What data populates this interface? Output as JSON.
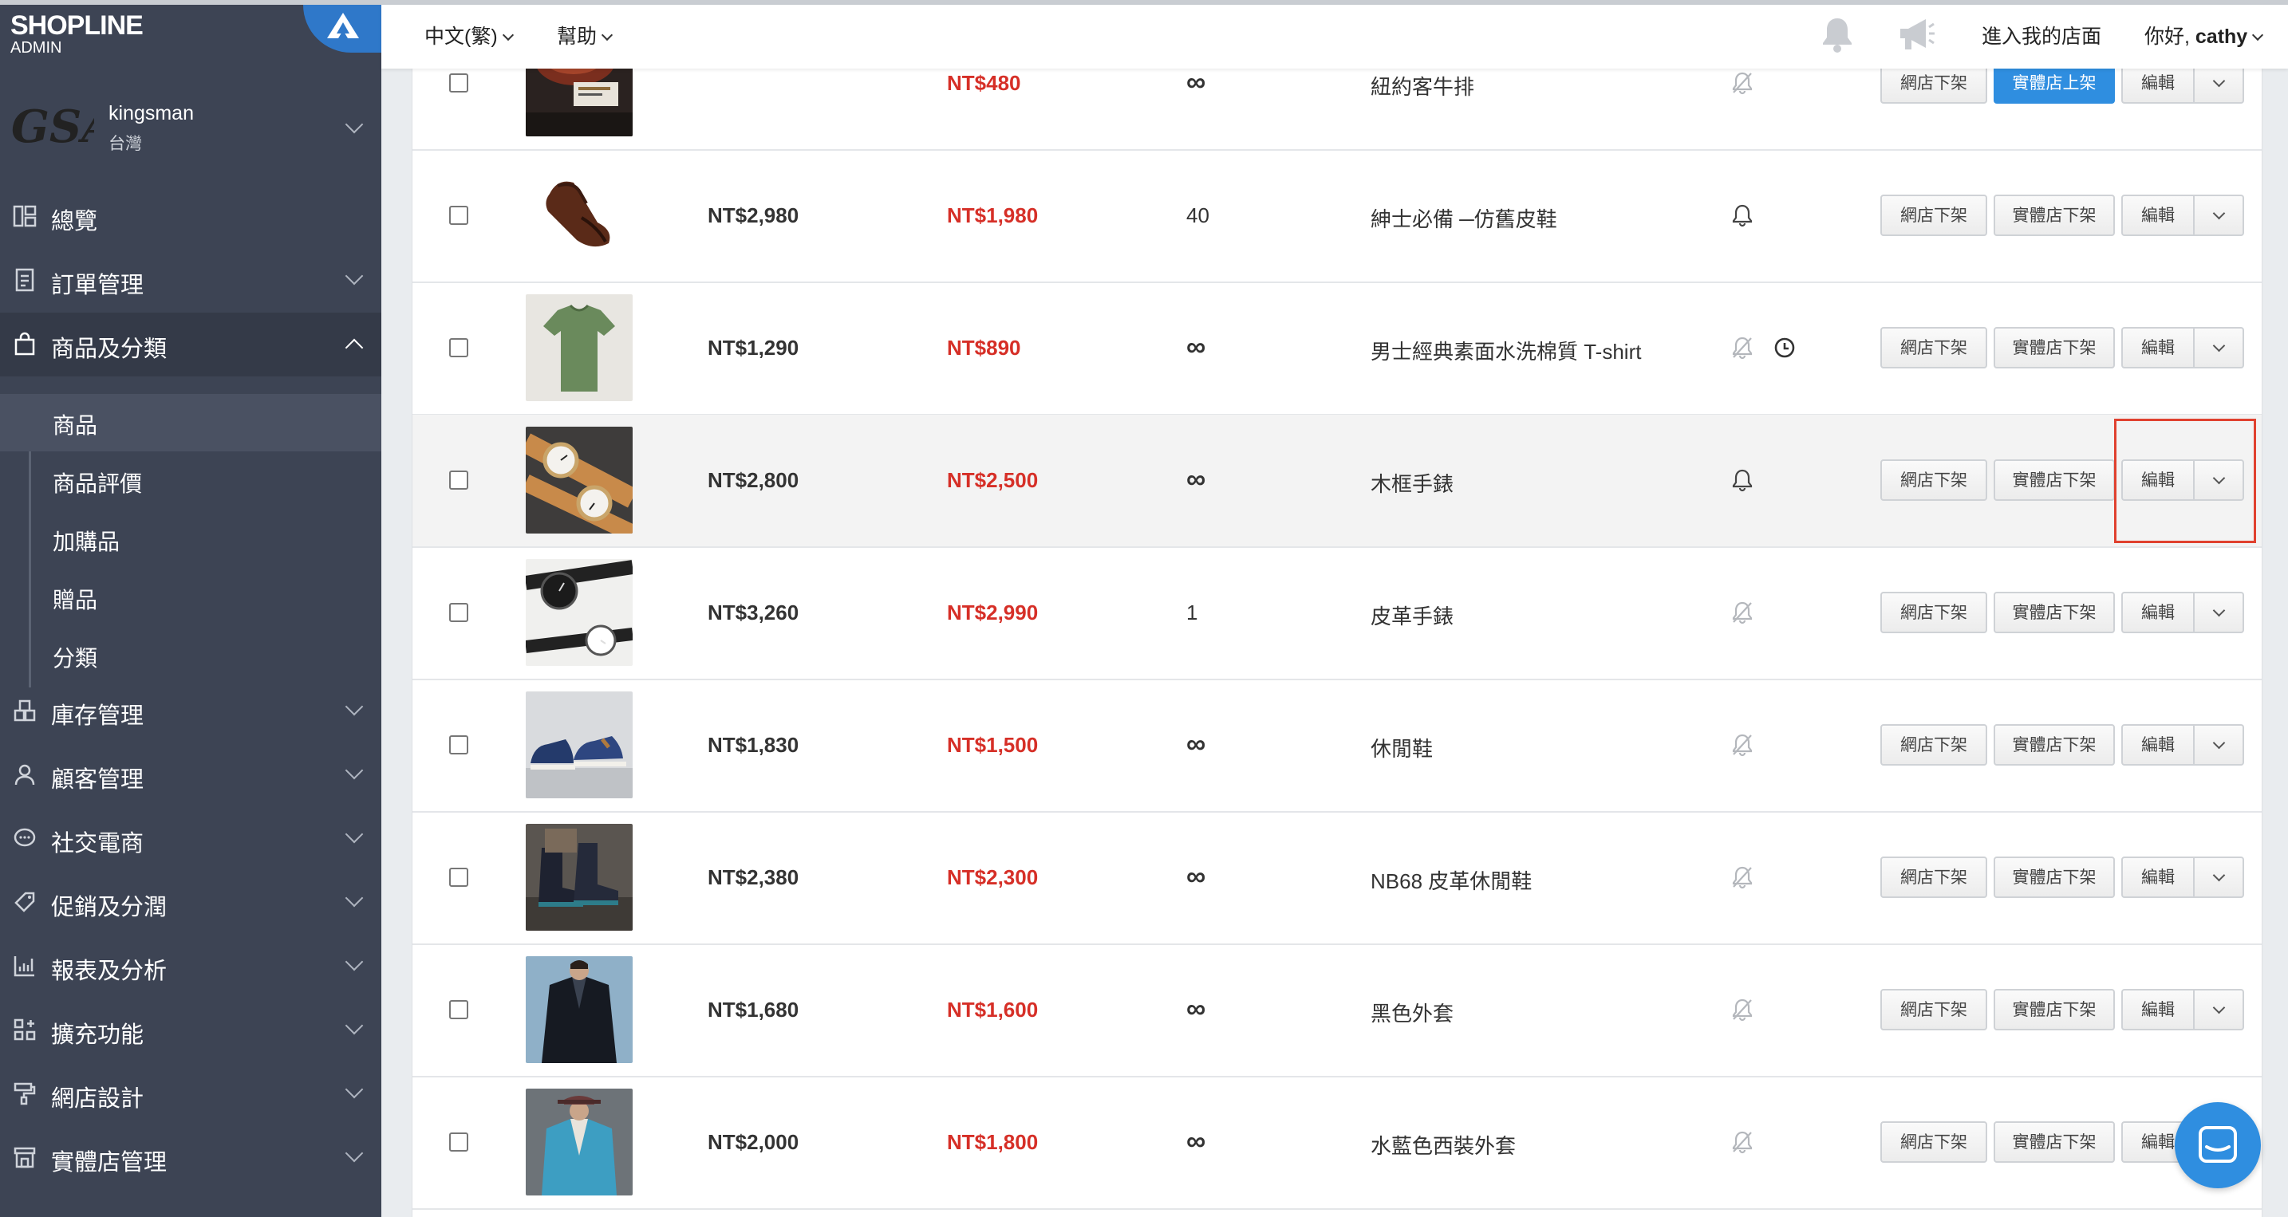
{
  "brand": {
    "logo_text": "SHOPLINE",
    "logo_sub": "ADMIN"
  },
  "store": {
    "avatar_text": "GSA",
    "name": "kingsman",
    "region": "台灣"
  },
  "nav": [
    {
      "label": "總覽",
      "icon": "dashboard-icon",
      "expandable": false
    },
    {
      "label": "訂單管理",
      "icon": "order-icon",
      "expandable": true
    },
    {
      "label": "商品及分類",
      "icon": "shopping-bag-icon",
      "expandable": true,
      "expanded": true
    },
    {
      "label": "庫存管理",
      "icon": "inventory-icon",
      "expandable": true
    },
    {
      "label": "顧客管理",
      "icon": "user-icon",
      "expandable": true
    },
    {
      "label": "社交電商",
      "icon": "chat-bubble-icon",
      "expandable": true
    },
    {
      "label": "促銷及分潤",
      "icon": "tag-icon",
      "expandable": true
    },
    {
      "label": "報表及分析",
      "icon": "chart-icon",
      "expandable": true
    },
    {
      "label": "擴充功能",
      "icon": "apps-icon",
      "expandable": true
    },
    {
      "label": "網店設計",
      "icon": "paint-roller-icon",
      "expandable": true
    },
    {
      "label": "實體店管理",
      "icon": "store-icon",
      "expandable": true
    }
  ],
  "subnav": [
    {
      "label": "商品",
      "active": true
    },
    {
      "label": "商品評價"
    },
    {
      "label": "加購品"
    },
    {
      "label": "贈品"
    },
    {
      "label": "分類"
    }
  ],
  "header": {
    "language": "中文(繁)",
    "help": "幫助",
    "visit_store": "進入我的店面",
    "greeting": "你好,",
    "username": "cathy"
  },
  "buttons": {
    "online_off": "網店下架",
    "retail_off": "實體店下架",
    "retail_on": "實體店上架",
    "edit": "編輯"
  },
  "products": [
    {
      "price": "",
      "sale": "NT$480",
      "qty": "∞",
      "name": "紐約客牛排",
      "bell": "off",
      "retail_btn": "實體店上架",
      "retail_primary": true,
      "thumb": "steak"
    },
    {
      "price": "NT$2,980",
      "sale": "NT$1,980",
      "qty": "40",
      "name": "紳士必備 ─仿舊皮鞋",
      "bell": "on",
      "retail_btn": "實體店下架",
      "thumb": "shoe"
    },
    {
      "price": "NT$1,290",
      "sale": "NT$890",
      "qty": "∞",
      "name": "男士經典素面水洗棉質 T-shirt",
      "bell": "off",
      "clock": true,
      "retail_btn": "實體店下架",
      "thumb": "tshirt"
    },
    {
      "price": "NT$2,800",
      "sale": "NT$2,500",
      "qty": "∞",
      "name": "木框手錶",
      "bell": "on",
      "retail_btn": "實體店下架",
      "thumb": "watch",
      "highlight": true
    },
    {
      "price": "NT$3,260",
      "sale": "NT$2,990",
      "qty": "1",
      "name": "皮革手錶",
      "bell": "off",
      "retail_btn": "實體店下架",
      "thumb": "watch2"
    },
    {
      "price": "NT$1,830",
      "sale": "NT$1,500",
      "qty": "∞",
      "name": "休閒鞋",
      "bell": "off",
      "retail_btn": "實體店下架",
      "thumb": "sneaker"
    },
    {
      "price": "NT$2,380",
      "sale": "NT$2,300",
      "qty": "∞",
      "name": "NB68 皮革休閒鞋",
      "bell": "off",
      "retail_btn": "實體店下架",
      "thumb": "boots"
    },
    {
      "price": "NT$1,680",
      "sale": "NT$1,600",
      "qty": "∞",
      "name": "黑色外套",
      "bell": "off",
      "retail_btn": "實體店下架",
      "thumb": "jacket"
    },
    {
      "price": "NT$2,000",
      "sale": "NT$1,800",
      "qty": "∞",
      "name": "水藍色西裝外套",
      "bell": "off",
      "retail_btn": "實體店下架",
      "thumb": "suit"
    }
  ],
  "colors": {
    "sidebar": "#3d4454",
    "accent": "#2f8ee0",
    "sale_red": "#d62f27",
    "highlight_box": "#e0412f"
  }
}
